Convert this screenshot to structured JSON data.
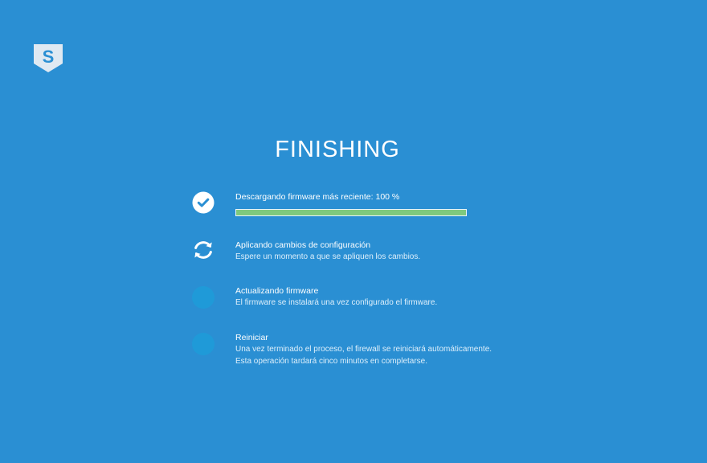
{
  "brand": {
    "logo_letter": "S",
    "logo_icon": "sophos-shield-icon"
  },
  "title": "FINISHING",
  "steps": [
    {
      "status": "done",
      "icon": "check-circle-icon",
      "title": "Descargando firmware más reciente: 100 %",
      "progress": 1.0
    },
    {
      "status": "in-progress",
      "icon": "refresh-icon",
      "title": "Aplicando cambios de configuración",
      "desc": [
        "Espere un momento a que se apliquen los cambios."
      ]
    },
    {
      "status": "pending",
      "icon": "pending-dot-icon",
      "title": "Actualizando firmware",
      "desc": [
        "El firmware se instalará una vez configurado el firmware."
      ]
    },
    {
      "status": "pending",
      "icon": "pending-dot-icon",
      "title": "Reiniciar",
      "desc": [
        "Una vez terminado el proceso, el firewall se reiniciará automáticamente.",
        "Esta operación tardará cinco minutos en completarse."
      ]
    }
  ],
  "colors": {
    "background": "#2a8fd3",
    "progress_fill": "#7ec97e",
    "pending_dot": "#1f9ad8"
  }
}
